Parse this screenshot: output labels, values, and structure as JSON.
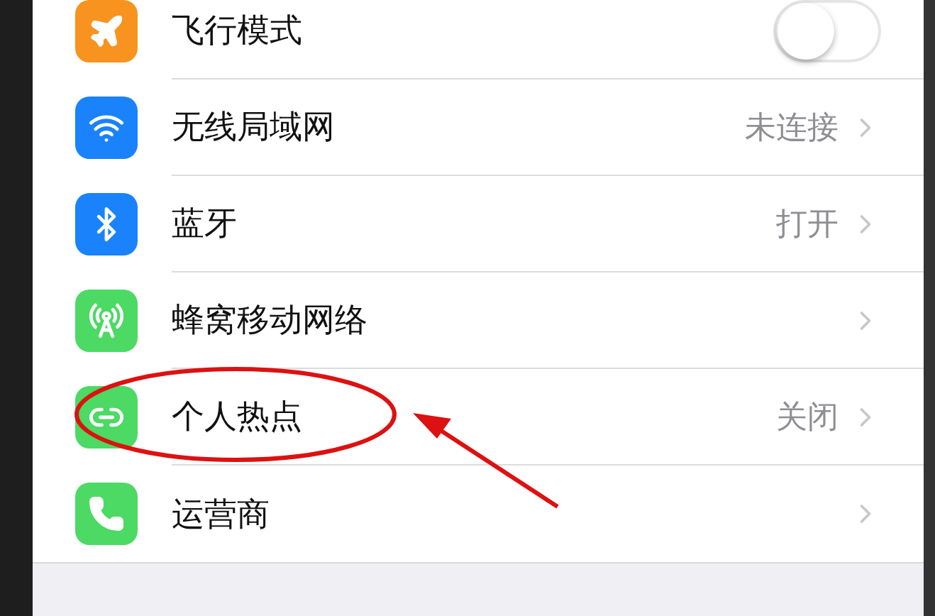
{
  "rows": [
    {
      "kind": "toggle",
      "label": "飞行模式",
      "color": "#f7931e",
      "on": false,
      "circled": false
    },
    {
      "kind": "link",
      "label": "无线局域网",
      "value": "未连接",
      "color": "#1a82fb",
      "circled": false
    },
    {
      "kind": "link",
      "label": "蓝牙",
      "value": "打开",
      "color": "#1a82fb",
      "circled": false
    },
    {
      "kind": "link",
      "label": "蜂窝移动网络",
      "color": "#4cd964",
      "circled": false
    },
    {
      "kind": "link",
      "label": "个人热点",
      "value": "关闭",
      "color": "#4cd964",
      "circled": true
    },
    {
      "kind": "link",
      "label": "运营商",
      "color": "#4cd964",
      "circled": false
    }
  ]
}
